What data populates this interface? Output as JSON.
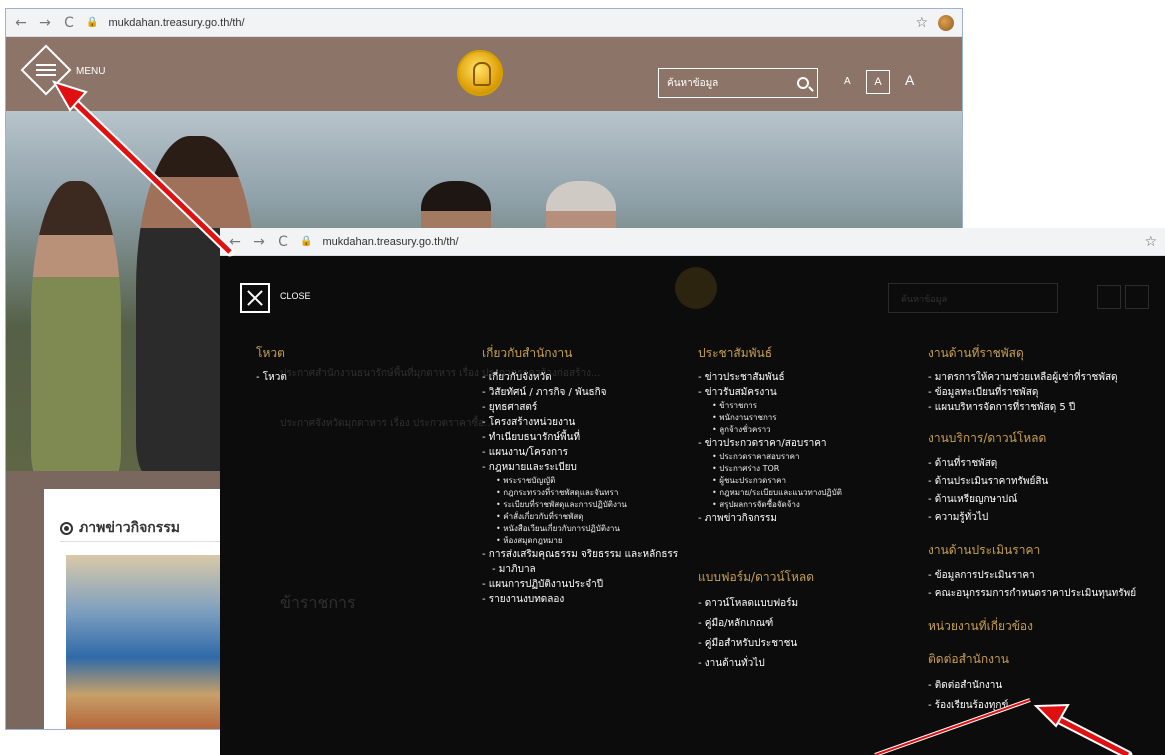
{
  "caption_text": "",
  "back_browser": {
    "url": "mukdahan.treasury.go.th/th/",
    "menu_label": "MENU",
    "search_placeholder": "ค้นหาข้อมูล",
    "font_sizes": [
      "A",
      "A",
      "A"
    ],
    "news_title": "ภาพข่าวกิจกรรม"
  },
  "front_browser": {
    "url": "mukdahan.treasury.go.th/th/",
    "close_label": "CLOSE",
    "ghost_search_placeholder": "ค้นหาข้อมูล",
    "ghost_section": "ข้าราชการ",
    "ghost_rows": [
      "ประกาศสำนักงานธนารักษ์พื้นที่มุกดาหาร เรื่อง ประกวดราคาจ้างก่อสร้าง...",
      "ประกาศจังหวัดมุกดาหาร เรื่อง ประกวดราคาซื้อ..."
    ],
    "menu": {
      "home": {
        "title": "โหวต",
        "items": [
          "โหวต"
        ]
      },
      "about": {
        "title": "เกี่ยวกับสำนักงาน",
        "items": [
          "เกี่ยวกับจังหวัด",
          "วิสัยทัศน์ / ภารกิจ / พันธกิจ",
          "ยุทธศาสตร์",
          "โครงสร้างหน่วยงาน",
          "ทำเนียบธนารักษ์พื้นที่",
          "แผนงาน/โครงการ",
          "กฎหมายและระเบียบ"
        ],
        "law_sub": [
          "พระราชบัญญัติ",
          "กฎกระทรวงที่ราชพัสดุและจันทรา",
          "ระเบียบที่ราชพัสดุและการปฏิบัติงาน",
          "คำสั่งเกี่ยวกับที่ราชพัสดุ",
          "หนังสือเวียนเกี่ยวกับการปฏิบัติงาน",
          "ห้องสมุดกฎหมาย"
        ],
        "items2": [
          "การส่งเสริมคุณธรรม จริยธรรม และหลักธรร",
          "มาภิบาล",
          "แผนการปฏิบัติงานประจำปี",
          "รายงานงบทดลอง"
        ]
      },
      "pr": {
        "title": "ประชาสัมพันธ์",
        "items": [
          "ข่าวประชาสัมพันธ์",
          "ข่าวรับสมัครงาน"
        ],
        "jobs_sub": [
          "ข้าราชการ",
          "พนักงานราชการ",
          "ลูกจ้างชั่วคราว"
        ],
        "items2": [
          "ข่าวประกวดราคา/สอบราคา"
        ],
        "bid_sub": [
          "ประกวดราคาสอบราคา",
          "ประกาศร่าง TOR",
          "ผู้ชนะประกวดราคา",
          "กฎหมาย/ระเบียบและแนวทางปฏิบัติ",
          "สรุปผลการจัดซื้อจัดจ้าง"
        ],
        "items3": [
          "ภาพข่าวกิจกรรม"
        ]
      },
      "forms": {
        "title": "แบบฟอร์ม/ดาวน์โหลด",
        "items": [
          "ดาวน์โหลดแบบฟอร์ม",
          "คู่มือ/หลักเกณฑ์",
          "คู่มือสำหรับประชาชน",
          "งานด้านทั่วไป"
        ]
      },
      "land": {
        "title": "งานด้านที่ราชพัสดุ",
        "items": [
          "มาตรการให้ความช่วยเหลือผู้เช่าที่ราชพัสดุ",
          "ข้อมูลทะเบียนที่ราชพัสดุ",
          "แผนบริหารจัดการที่ราชพัสดุ 5 ปี"
        ]
      },
      "service": {
        "title": "งานบริการ/ดาวน์โหลด",
        "items": [
          "ด้านที่ราชพัสดุ",
          "ด้านประเมินราคาทรัพย์สิน",
          "ด้านเหรียญกษาปณ์",
          "ความรู้ทั่วไป"
        ]
      },
      "appraisal": {
        "title": "งานด้านประเมินราคา",
        "items": [
          "ข้อมูลการประเมินราคา",
          "คณะอนุกรรมการกำหนดราคาประเมินทุนทรัพย์"
        ]
      },
      "related": {
        "title": "หน่วยงานที่เกี่ยวข้อง"
      },
      "contact": {
        "title": "ติดต่อสำนักงาน",
        "items": [
          "ติดต่อสำนักงาน",
          "ร้องเรียนร้องทุกข์"
        ]
      }
    }
  },
  "colors": {
    "header_bg": "#8c7568",
    "overlay_bg": "#0c0c0c",
    "menu_title": "#c8a050",
    "arrow": "#e01010"
  }
}
